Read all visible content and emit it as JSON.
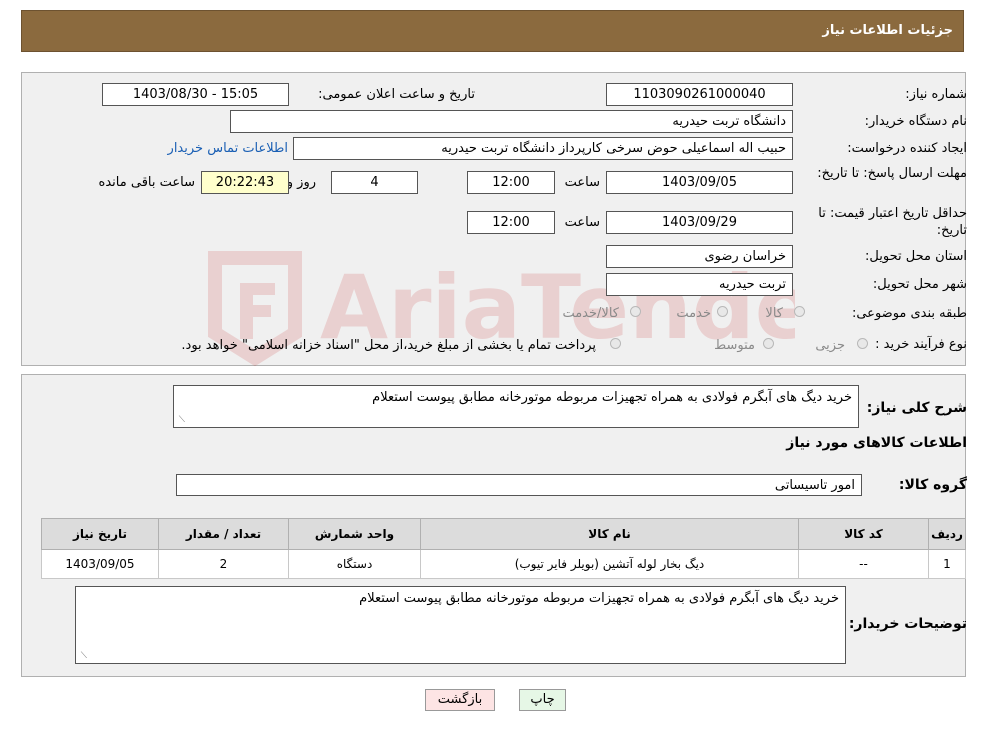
{
  "header": {
    "title": "جزئیات اطلاعات نیاز"
  },
  "form": {
    "need_number_label": "شماره نیاز:",
    "need_number": "1103090261000040",
    "announce_label": "تاریخ و ساعت اعلان عمومی:",
    "announce_value": "1403/08/30 - 15:05",
    "buyer_org_label": "نام دستگاه خریدار:",
    "buyer_org": "دانشگاه تربت حیدریه",
    "creator_label": "ایجاد کننده درخواست:",
    "creator": "حبیب اله اسماعیلی حوض سرخی کارپرداز دانشگاه تربت حیدریه",
    "contact_link": "اطلاعات تماس خریدار",
    "deadline_label": "مهلت ارسال پاسخ: تا تاریخ:",
    "deadline_date": "1403/09/05",
    "time_label": "ساعت",
    "deadline_time": "12:00",
    "days": "4",
    "days_label": "روز و",
    "remaining_time": "20:22:43",
    "remaining_label": "ساعت باقی مانده",
    "validity_label": "حداقل تاریخ اعتبار قیمت: تا تاریخ:",
    "validity_date": "1403/09/29",
    "validity_time": "12:00",
    "province_label": "استان محل تحویل:",
    "province": "خراسان رضوی",
    "city_label": "شهر محل تحویل:",
    "city": "تربت حیدریه",
    "category_label": "طبقه بندی موضوعی:",
    "category_options": [
      "کالا",
      "خدمت",
      "کالا/خدمت"
    ],
    "process_label": "نوع فرآیند خرید :",
    "process_options": [
      "جزیی",
      "متوسط"
    ],
    "process_note": "پرداخت تمام یا بخشی از مبلغ خرید،از محل \"اسناد خزانه اسلامی\" خواهد بود."
  },
  "details": {
    "summary_label": "شرح کلی نیاز:",
    "summary": "خرید دیگ های آبگرم فولادی به همراه تجهیزات مربوطه موتورخانه مطابق پیوست استعلام",
    "goods_info_title": "اطلاعات کالاهای مورد نیاز",
    "goods_group_label": "گروه کالا:",
    "goods_group": "امور تاسیساتی",
    "table": {
      "headers": [
        "ردیف",
        "کد کالا",
        "نام کالا",
        "واحد شمارش",
        "تعداد / مقدار",
        "تاریخ نیاز"
      ],
      "rows": [
        [
          "1",
          "--",
          "دیگ بخار لوله آتشین (بویلر فایر تیوب)",
          "دستگاه",
          "2",
          "1403/09/05"
        ]
      ]
    },
    "buyer_notes_label": "توضیحات خریدار:",
    "buyer_notes": "خرید دیگ های آبگرم فولادی به همراه تجهیزات مربوطه موتورخانه مطابق پیوست استعلام"
  },
  "buttons": {
    "print": "چاپ",
    "back": "بازگشت"
  },
  "watermark_text": "AriaTender.neT",
  "colors": {
    "header_bg": "#8b6a3e",
    "print_bg": "#e6f7e6",
    "back_bg": "#fde4e4",
    "link": "#1a5fb4"
  }
}
